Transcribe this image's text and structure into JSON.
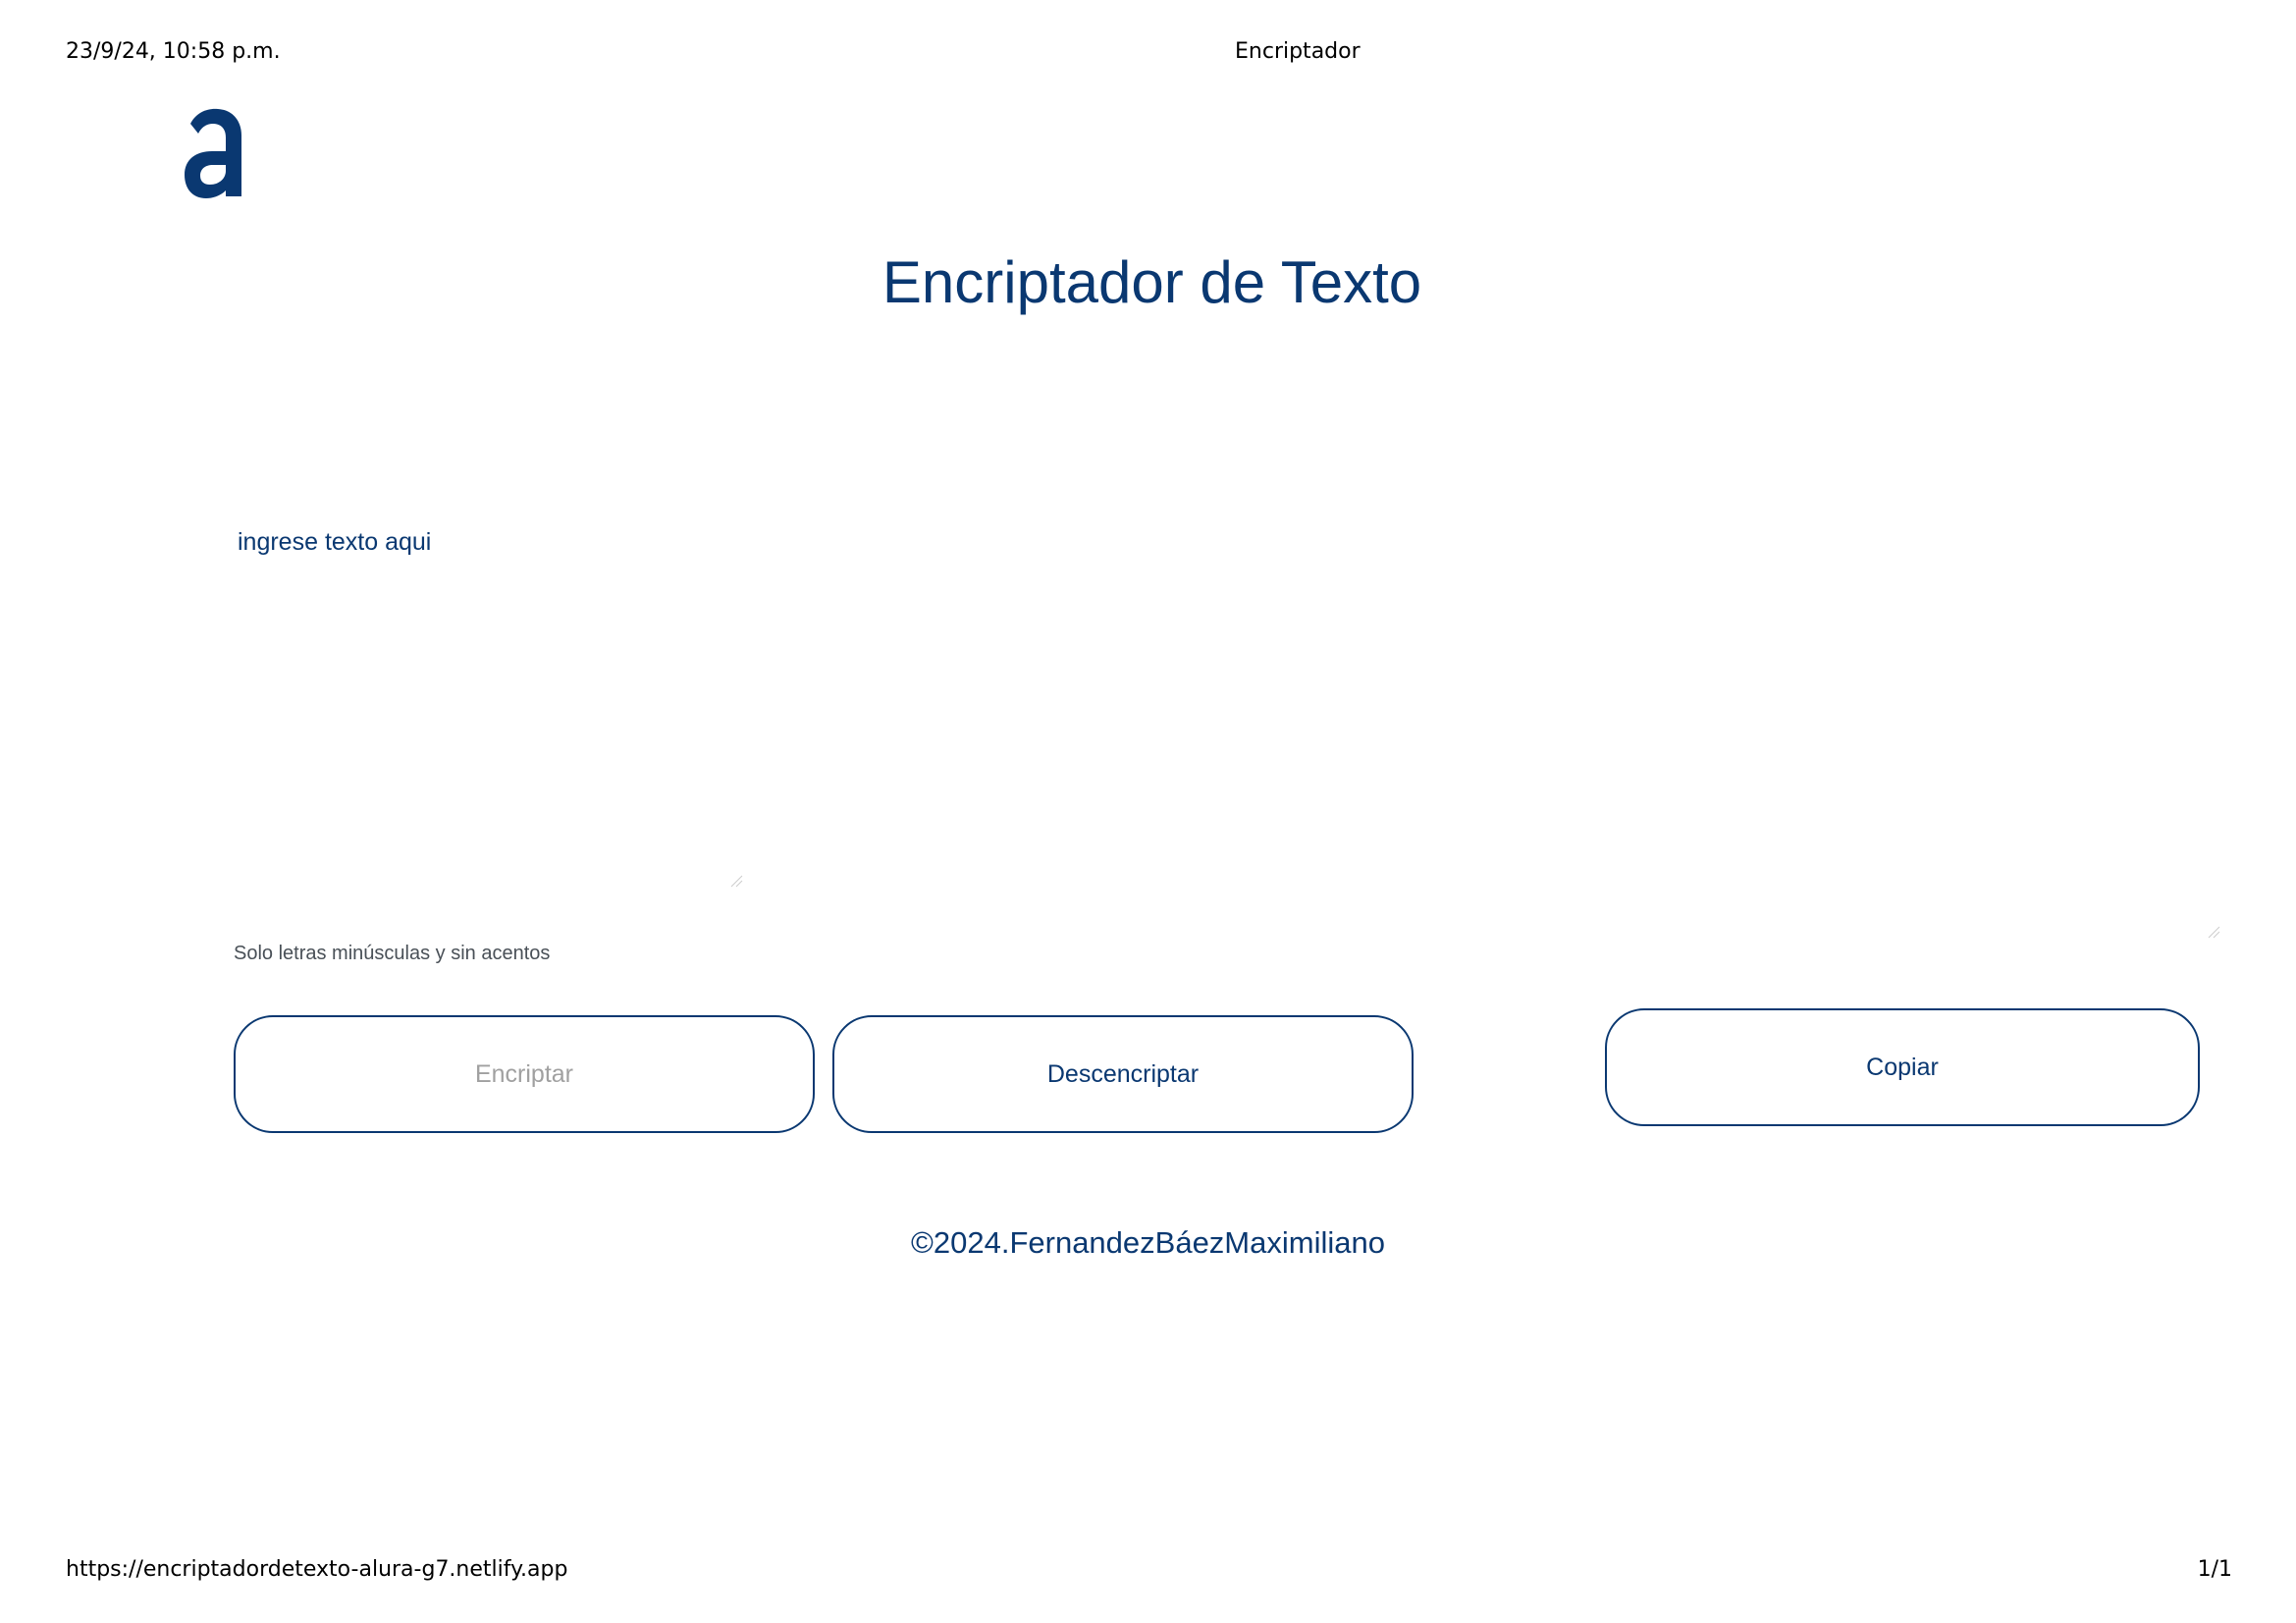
{
  "print_header": {
    "date": "23/9/24, 10:58 p.m.",
    "title": "Encriptador"
  },
  "print_footer": {
    "url": "https://encriptadordetexto-alura-g7.netlify.app",
    "page": "1/1"
  },
  "logo": {
    "icon": "alura-logo-icon",
    "color": "#0a3871"
  },
  "main": {
    "title": "Encriptador de Texto",
    "input_placeholder": "ingrese texto aqui",
    "hint": "Solo letras minúsculas y sin acentos",
    "buttons": {
      "encrypt": "Encriptar",
      "decrypt": "Descencriptar",
      "copy": "Copiar"
    }
  },
  "footer": {
    "copyright": "©2024.FernandezBáezMaximiliano"
  },
  "colors": {
    "primary": "#0a3871",
    "muted_text": "#495057",
    "disabled_text": "#a0a0a0",
    "background": "#ffffff"
  }
}
